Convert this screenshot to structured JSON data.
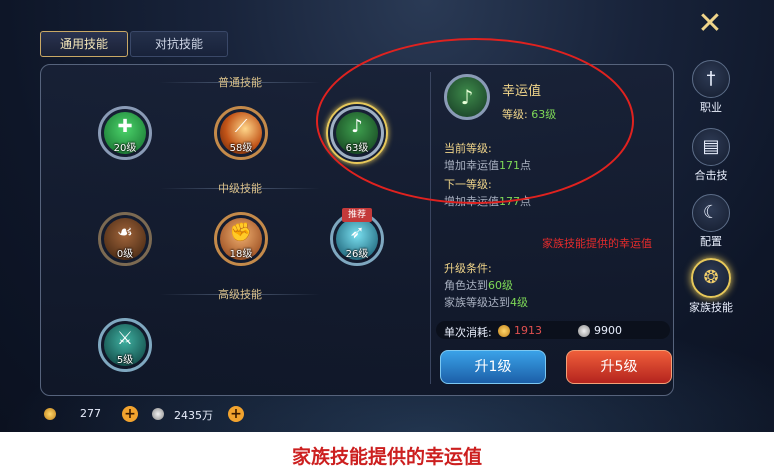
{
  "tabs": {
    "general": "通用技能",
    "versus": "对抗技能"
  },
  "sections": {
    "normal": "普通技能",
    "intermediate": "中级技能",
    "advanced": "高级技能"
  },
  "skills": [
    {
      "level": "20级",
      "icon": "heal-cross-icon"
    },
    {
      "level": "58级",
      "icon": "slash-icon"
    },
    {
      "level": "63级",
      "icon": "luck-note-icon"
    },
    {
      "level": "0级",
      "icon": "beast-icon"
    },
    {
      "level": "18级",
      "icon": "strength-arm-icon"
    },
    {
      "level": "26级",
      "icon": "arrow-volley-icon",
      "badge": "推荐"
    },
    {
      "level": "5级",
      "icon": "sword-shield-icon"
    }
  ],
  "detail": {
    "name": "幸运值",
    "level_label": "等级:",
    "level_value": "63级",
    "current_title": "当前等级:",
    "current_prefix": "增加幸运值",
    "current_value": "171",
    "current_suffix": "点",
    "next_title": "下一等级:",
    "next_prefix": "增加幸运值",
    "next_value": "177",
    "next_suffix": "点",
    "note": "家族技能提供的幸运值",
    "req_title": "升级条件:",
    "req1_prefix": "角色达到",
    "req1_value": "60级",
    "req2_prefix": "家族等级达到",
    "req2_value": "4级",
    "cost_label": "单次消耗:",
    "cost_gold": "1913",
    "cost_silver": "9900",
    "btn_up1": "升1级",
    "btn_up5": "升5级"
  },
  "side_menu": [
    {
      "label": "职业",
      "icon": "sword-icon"
    },
    {
      "label": "合击技",
      "icon": "book-icon"
    },
    {
      "label": "配置",
      "icon": "moon-icon"
    },
    {
      "label": "家族技能",
      "icon": "family-crest-icon"
    }
  ],
  "currency": {
    "gold": "277",
    "silver": "2435万"
  },
  "caption": "家族技能提供的幸运值",
  "colors": {
    "accent_gold": "#e7c85a",
    "annotation_red": "#e0221f",
    "value_green": "#7ed957"
  }
}
